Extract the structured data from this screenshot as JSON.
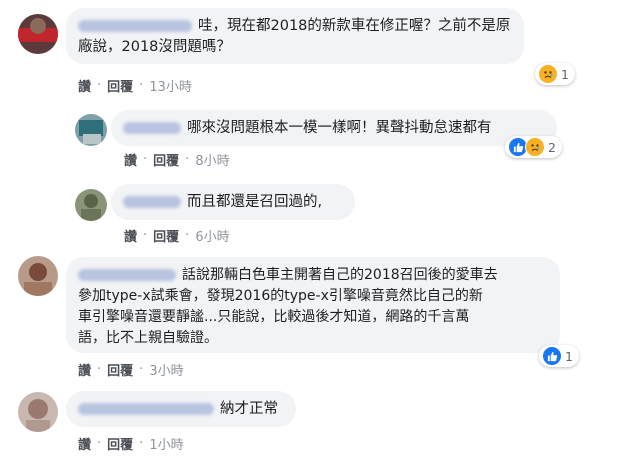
{
  "comments": [
    {
      "text_line1": "哇，現在都2018的新款車在修正喔？之前不是原",
      "text_line2": "廠說，2018沒問題嗎？",
      "actions": {
        "like": "讚",
        "reply": "回覆",
        "time": "13小時"
      },
      "reaction_count": "1",
      "reactions": [
        "sad-icon"
      ]
    },
    {
      "text": "哪來沒問題根本一模一樣啊！異聲抖動怠速都有",
      "actions": {
        "like": "讚",
        "reply": "回覆",
        "time": "8小時"
      },
      "reaction_count": "2",
      "reactions": [
        "like-icon",
        "sad-icon"
      ]
    },
    {
      "text": "而且都還是召回過的,",
      "actions": {
        "like": "讚",
        "reply": "回覆",
        "time": "6小時"
      }
    },
    {
      "text_line1": "話說那輛白色車主開著自己的2018召回後的愛車去",
      "text_line2": "參加type-x試乘會，發現2016的type-x引擎噪音竟然比自己的新",
      "text_line3": "車引擎噪音還要靜謐...只能說，比較過後才知道，網路的千言萬",
      "text_line4": "語，比不上親自驗證。",
      "actions": {
        "like": "讚",
        "reply": "回覆",
        "time": "3小時"
      },
      "reaction_count": "1",
      "reactions": [
        "like-icon"
      ]
    },
    {
      "text": "納才正常",
      "actions": {
        "like": "讚",
        "reply": "回覆",
        "time": "1小時"
      }
    }
  ]
}
